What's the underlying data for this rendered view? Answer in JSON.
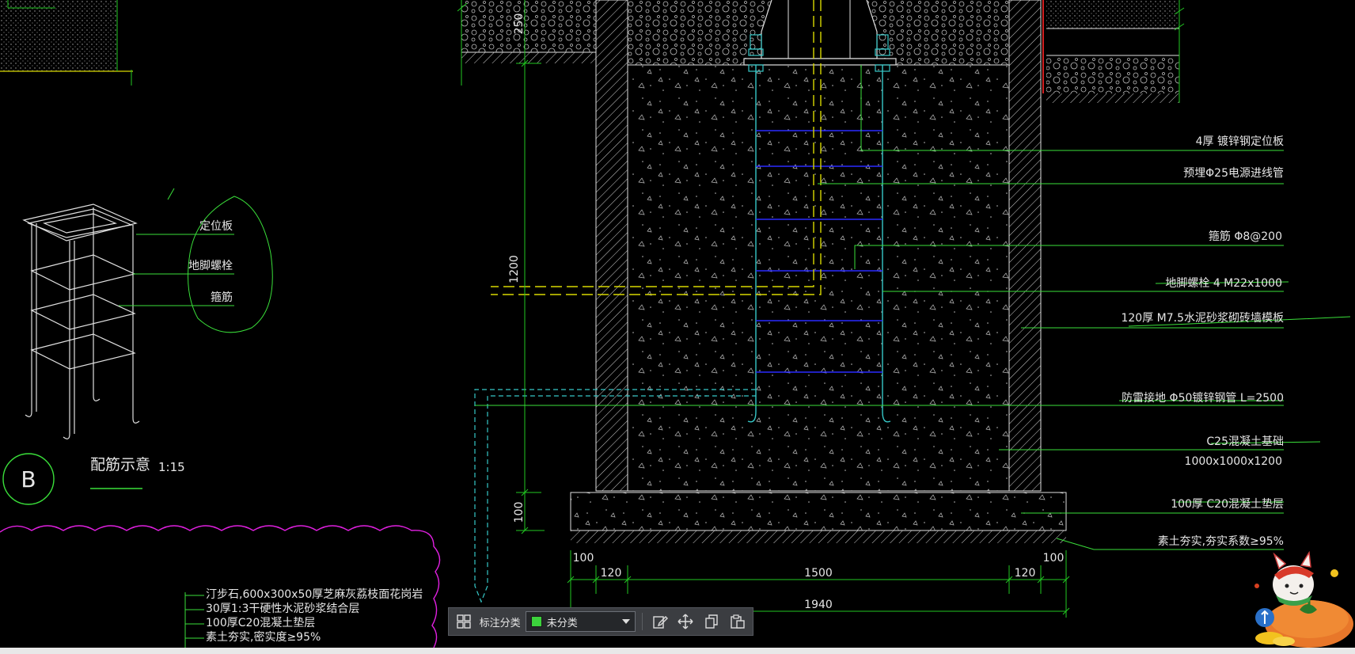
{
  "colors": {
    "background": "#000000",
    "dim_green": "#22c822",
    "leader_green": "#3adf3a",
    "bolt_cyan": "#36c8c8",
    "stirrup_blue": "#2a2aff",
    "conduit_yellow": "#d8d800",
    "wall_white": "#e0e0e0",
    "revision_magenta": "#e020e0",
    "swatch_green": "#3cd23c"
  },
  "section": {
    "dimensions": {
      "d250": "250",
      "d1200": "1200",
      "d100_left": "100",
      "d100_bl": "100",
      "d100_br": "100",
      "d120_l": "120",
      "d1500": "1500",
      "d120_r": "120",
      "d1940": "1940"
    },
    "callouts": [
      "4厚 镀锌钢定位板",
      "预埋Φ25电源进线管",
      "箍筋 Φ8@200",
      "地脚螺栓 4 M22x1000",
      "120厚 M7.5水泥砂浆砌砖墙模板",
      "防雷接地 Φ50镀锌钢管 L=2500",
      "C25混凝土基础",
      "1000x1000x1200",
      "100厚 C20混凝土垫层",
      "素土夯实,夯实系数≥95%"
    ]
  },
  "detail_b": {
    "labels": [
      "定位板",
      "地脚螺栓",
      "箍筋"
    ],
    "marker": "B",
    "title": "配筋示意",
    "scale": "1:15"
  },
  "paving_layers": [
    "汀步石,600x300x50厚芝麻灰荔枝面花岗岩",
    "30厚1:3干硬性水泥砂浆结合层",
    "100厚C20混凝土垫层",
    "素土夯实,密实度≥95%"
  ],
  "toolbar": {
    "label": "标注分类",
    "selected_value": "未分类",
    "icons": [
      "grid-icon",
      "edit-icon",
      "move-icon",
      "copy-icon",
      "paste-icon"
    ]
  }
}
